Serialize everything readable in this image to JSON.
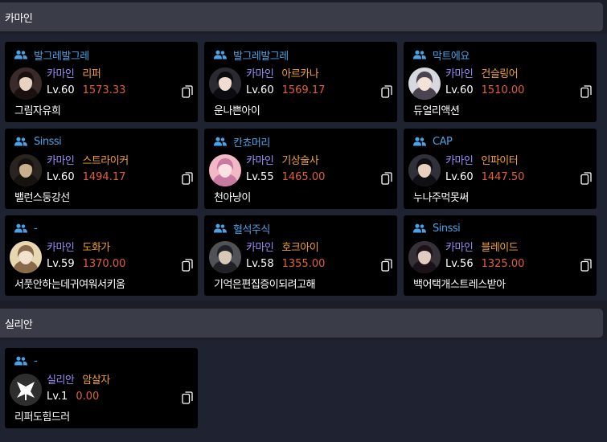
{
  "sections": [
    {
      "title": "카마인",
      "cards": [
        {
          "guild": "발그레발그레",
          "server": "카마인",
          "class": "리퍼",
          "level": "Lv.60",
          "item_level": "1573.33",
          "name": "그림자유희",
          "avatar": "reaper-avatar"
        },
        {
          "guild": "발그레발그레",
          "server": "카마인",
          "class": "아르카나",
          "level": "Lv.60",
          "item_level": "1569.17",
          "name": "운나쁜아이",
          "avatar": "arcana-avatar"
        },
        {
          "guild": "막트에요",
          "server": "카마인",
          "class": "건슬링어",
          "level": "Lv.60",
          "item_level": "1510.00",
          "name": "듀얼리액션",
          "avatar": "gunslinger-avatar"
        },
        {
          "guild": "Sinssi",
          "server": "카마인",
          "class": "스트라이커",
          "level": "Lv.60",
          "item_level": "1494.17",
          "name": "밸런스둥강선",
          "avatar": "striker-avatar"
        },
        {
          "guild": "칸쵸머리",
          "server": "카마인",
          "class": "기상술사",
          "level": "Lv.55",
          "item_level": "1465.00",
          "name": "천아냥이",
          "avatar": "aeromancer-avatar"
        },
        {
          "guild": "CAP",
          "server": "카마인",
          "class": "인파이터",
          "level": "Lv.60",
          "item_level": "1447.50",
          "name": "누나주먹못써",
          "avatar": "infighter-avatar"
        },
        {
          "guild": "-",
          "server": "카마인",
          "class": "도화가",
          "level": "Lv.59",
          "item_level": "1370.00",
          "name": "서풋안하는데귀여워서키움",
          "avatar": "artist-avatar"
        },
        {
          "guild": "혈석주식",
          "server": "카마인",
          "class": "호크아이",
          "level": "Lv.58",
          "item_level": "1355.00",
          "name": "기억은편집증이되려고해",
          "avatar": "hawkeye-avatar"
        },
        {
          "guild": "Sinssi",
          "server": "카마인",
          "class": "블레이드",
          "level": "Lv.56",
          "item_level": "1325.00",
          "name": "백어택개스트레스받아",
          "avatar": "blade-avatar"
        }
      ]
    },
    {
      "title": "실리안",
      "cards": [
        {
          "guild": "-",
          "server": "실리안",
          "class": "암살자",
          "level": "Lv.1",
          "item_level": "0.00",
          "name": "리퍼도힘드러",
          "avatar": "assassin-emblem"
        }
      ]
    }
  ],
  "colors": {
    "page_bg": "#1b1e27",
    "header_bg": "#3a3d47",
    "card_bg": "#000000",
    "guild": "#4aa3e6",
    "server": "#9a8cf5",
    "class": "#f0a030",
    "item_level": "#e0603a"
  },
  "icons": {
    "guild": "users-icon",
    "copy": "copy-icon"
  }
}
